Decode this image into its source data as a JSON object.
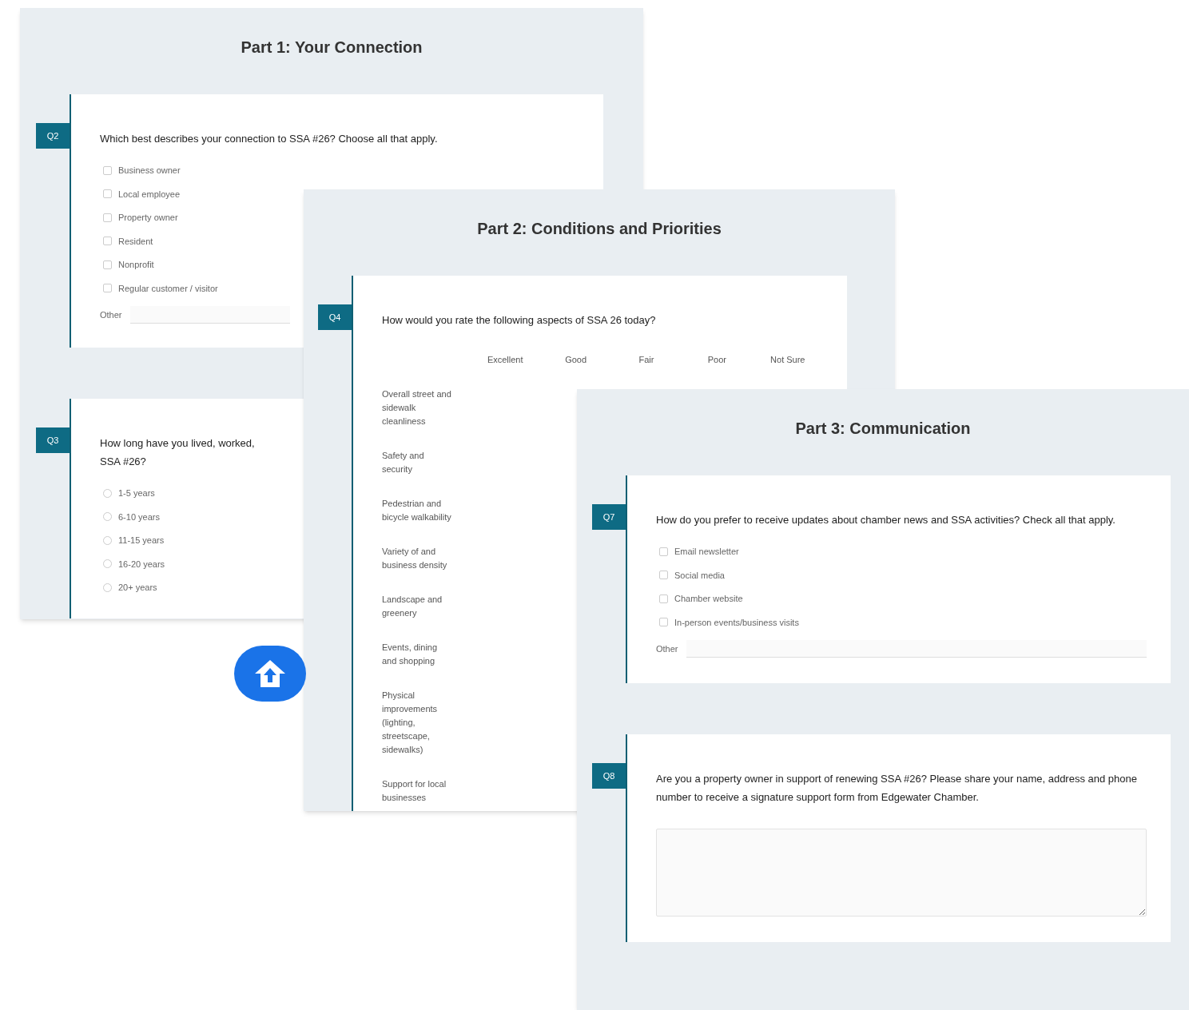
{
  "panels": [
    {
      "title": "Part 1: Your Connection",
      "questions": [
        {
          "number": "Q2",
          "kind": "checkboxes",
          "lines": [
            "Which best describes your connection to SSA #26? Choose all that apply."
          ],
          "options": [
            {
              "label": "Business owner",
              "checked": false
            },
            {
              "label": "Local employee",
              "checked": false
            },
            {
              "label": "Property owner",
              "checked": false
            },
            {
              "label": "Resident",
              "checked": false
            },
            {
              "label": "Nonprofit",
              "checked": false
            },
            {
              "label": "Regular customer / visitor",
              "checked": false
            }
          ],
          "other": {
            "label": "Other"
          }
        },
        {
          "number": "Q3",
          "kind": "radios",
          "lines": [
            "How long have you lived, worked,",
            "SSA #26?"
          ],
          "options": [
            {
              "label": "1-5 years",
              "checked": false
            },
            {
              "label": "6-10 years",
              "checked": false
            },
            {
              "label": "11-15 years",
              "checked": false
            },
            {
              "label": "16-20 years",
              "checked": false
            },
            {
              "label": "20+ years",
              "checked": false
            }
          ]
        }
      ]
    },
    {
      "title": "Part 2: Conditions and Priorities",
      "questions": [
        {
          "number": "Q4",
          "kind": "matrix",
          "lines": [
            "How would you rate the following aspects of SSA 26 today?"
          ],
          "columns": [
            "Excellent",
            "Good",
            "Fair",
            "Poor",
            "Not Sure"
          ],
          "rows": [
            "Overall street and sidewalk cleanliness",
            "Safety and security",
            "Pedestrian and bicycle walkability",
            "Variety of and business density",
            "Landscape and greenery",
            "Events, dining and shopping",
            "Physical improvements (lighting, streetscape, sidewalks)",
            "Support for local businesses"
          ]
        }
      ]
    },
    {
      "title": "Part 3: Communication",
      "questions": [
        {
          "number": "Q7",
          "kind": "checkboxes",
          "lines": [
            "How do you prefer to receive updates about chamber news and SSA activities? Check all that apply."
          ],
          "options": [
            {
              "label": "Email newsletter",
              "checked": false
            },
            {
              "label": "Social media",
              "checked": false
            },
            {
              "label": "Chamber website",
              "checked": false
            },
            {
              "label": "In-person events/business visits",
              "checked": false
            }
          ],
          "other": {
            "label": "Other"
          }
        },
        {
          "number": "Q8",
          "kind": "textarea",
          "lines": [
            "Are you a property owner in support of renewing SSA #26? Please share your name, address and phone number to receive a signature support form from Edgewater Chamber."
          ]
        }
      ]
    }
  ]
}
